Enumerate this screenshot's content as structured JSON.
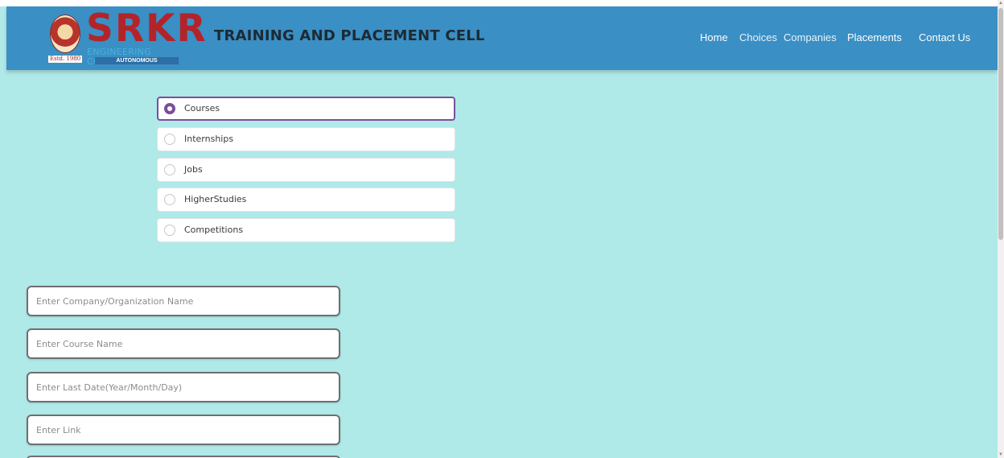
{
  "header": {
    "logo": {
      "wordmark": "SRKR",
      "subtitle": "ENGINEERING COLLEGE",
      "tagline": "AUTONOMOUS",
      "established": "Estd. 1980",
      "emblem_icon": "college-emblem-icon"
    },
    "title": "TRAINING AND PLACEMENT CELL",
    "nav": [
      {
        "label": "Home"
      },
      {
        "label": "Choices"
      },
      {
        "label": "Companies"
      },
      {
        "label": "Placements"
      },
      {
        "label": "Contact Us"
      }
    ]
  },
  "choices": {
    "selected": "Courses",
    "options": [
      {
        "label": "Courses"
      },
      {
        "label": "Internships"
      },
      {
        "label": "Jobs"
      },
      {
        "label": "HigherStudies"
      },
      {
        "label": "Competitions"
      }
    ]
  },
  "form": {
    "fields": [
      {
        "placeholder": "Enter Company/Organization Name",
        "value": ""
      },
      {
        "placeholder": "Enter Course Name",
        "value": ""
      },
      {
        "placeholder": "Enter Last Date(Year/Month/Day)",
        "value": ""
      },
      {
        "placeholder": "Enter Link",
        "value": ""
      }
    ]
  },
  "colors": {
    "background": "#afe9e8",
    "navbar": "#3a8fc4",
    "brand_red": "#b3242a",
    "radio_accent": "#7b4e9c"
  }
}
